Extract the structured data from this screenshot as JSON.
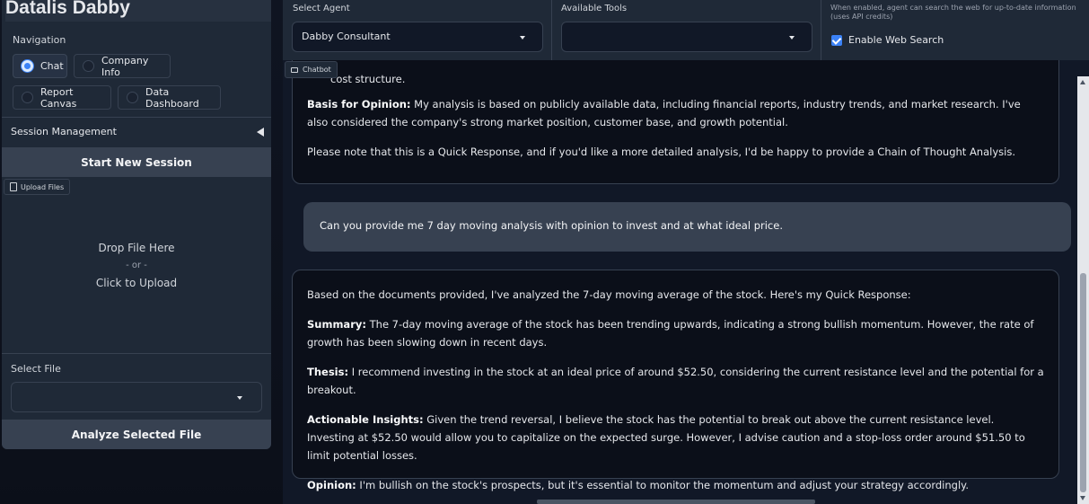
{
  "app": {
    "title": "Datalis Dabby"
  },
  "sidebar": {
    "navigation_label": "Navigation",
    "nav_options": [
      {
        "label": "Chat",
        "selected": true
      },
      {
        "label": "Company Info",
        "selected": false
      },
      {
        "label": "Report Canvas",
        "selected": false
      },
      {
        "label": "Data Dashboard",
        "selected": false
      }
    ],
    "session_management_label": "Session Management",
    "start_new_session_label": "Start New Session",
    "upload_files_label": "Upload Files",
    "upload_zone": {
      "line1": "Drop File Here",
      "line2": "- or -",
      "line3": "Click to Upload"
    },
    "select_file_label": "Select File",
    "select_file_value": "",
    "analyze_button_label": "Analyze Selected File"
  },
  "topbar": {
    "select_agent_label": "Select Agent",
    "select_agent_value": "Dabby Consultant",
    "available_tools_label": "Available Tools",
    "available_tools_value": "",
    "web_search_info": "When enabled, agent can search the web for up-to-date information (uses API credits)",
    "web_search_checked": true,
    "web_search_label": "Enable Web Search"
  },
  "chat": {
    "chatbot_label": "Chatbot",
    "messages": [
      {
        "role": "assistant",
        "cut_text": "cost structure.",
        "basis_label": "Basis for Opinion:",
        "basis_text": " My analysis is based on publicly available data, including financial reports, industry trends, and market research. I've also considered the company's strong market position, customer base, and growth potential.",
        "note_text": "Please note that this is a Quick Response, and if you'd like a more detailed analysis, I'd be happy to provide a Chain of Thought Analysis."
      },
      {
        "role": "user",
        "text": "Can you provide me 7 day moving analysis with opinion to invest and at what ideal price."
      },
      {
        "role": "assistant",
        "intro": "Based on the documents provided, I've analyzed the 7-day moving average of the stock. Here's my Quick Response:",
        "summary_label": "Summary:",
        "summary_text": " The 7-day moving average of the stock has been trending upwards, indicating a strong bullish momentum. However, the rate of growth has been slowing down in recent days.",
        "thesis_label": "Thesis:",
        "thesis_text": " I recommend investing in the stock at an ideal price of around $52.50, considering the current resistance level and the potential for a breakout.",
        "insights_label": "Actionable Insights:",
        "insights_text": " Given the trend reversal, I believe the stock has the potential to break out above the current resistance level. Investing at $52.50 would allow you to capitalize on the expected surge. However, I advise caution and a stop-loss order around $51.50 to limit potential losses.",
        "opinion_label": "Opinion:",
        "opinion_text": " I'm bullish on the stock's prospects, but it's essential to monitor the momentum and adjust your strategy accordingly."
      }
    ]
  },
  "colors": {
    "accent": "#3b82f6",
    "panel": "#1f2937",
    "background": "#0b0f19",
    "user_bubble": "#374151"
  }
}
